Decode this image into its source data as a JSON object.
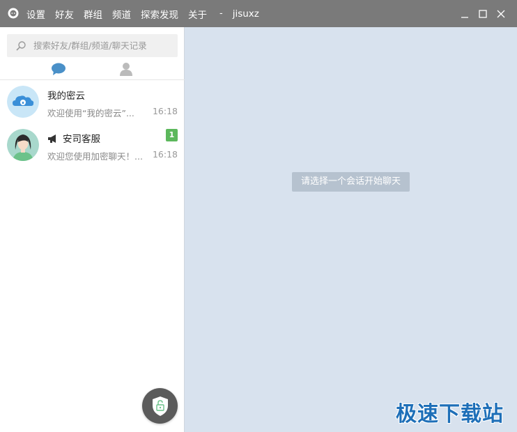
{
  "titlebar": {
    "menu": [
      "设置",
      "好友",
      "群组",
      "频道",
      "探索发现",
      "关于"
    ],
    "separator": "-",
    "username": "jisuxz"
  },
  "sidebar": {
    "search_placeholder": "搜索好友/群组/频道/聊天记录",
    "conversations": [
      {
        "name": "我的密云",
        "preview": "欢迎使用“我的密云”...",
        "time": "16:18",
        "avatar": "cloud-lock-icon"
      },
      {
        "name": "安司客服",
        "preview": "欢迎您使用加密聊天！...",
        "time": "16:18",
        "badge": "1",
        "avatar": "woman-avatar"
      }
    ]
  },
  "main": {
    "hint": "请选择一个会话开始聊天",
    "watermark": "极速下载站"
  },
  "colors": {
    "titlebar": "#7a7a7a",
    "main_bg": "#d8e2ee",
    "badge": "#5cb85c",
    "accent": "#4a90c8"
  }
}
